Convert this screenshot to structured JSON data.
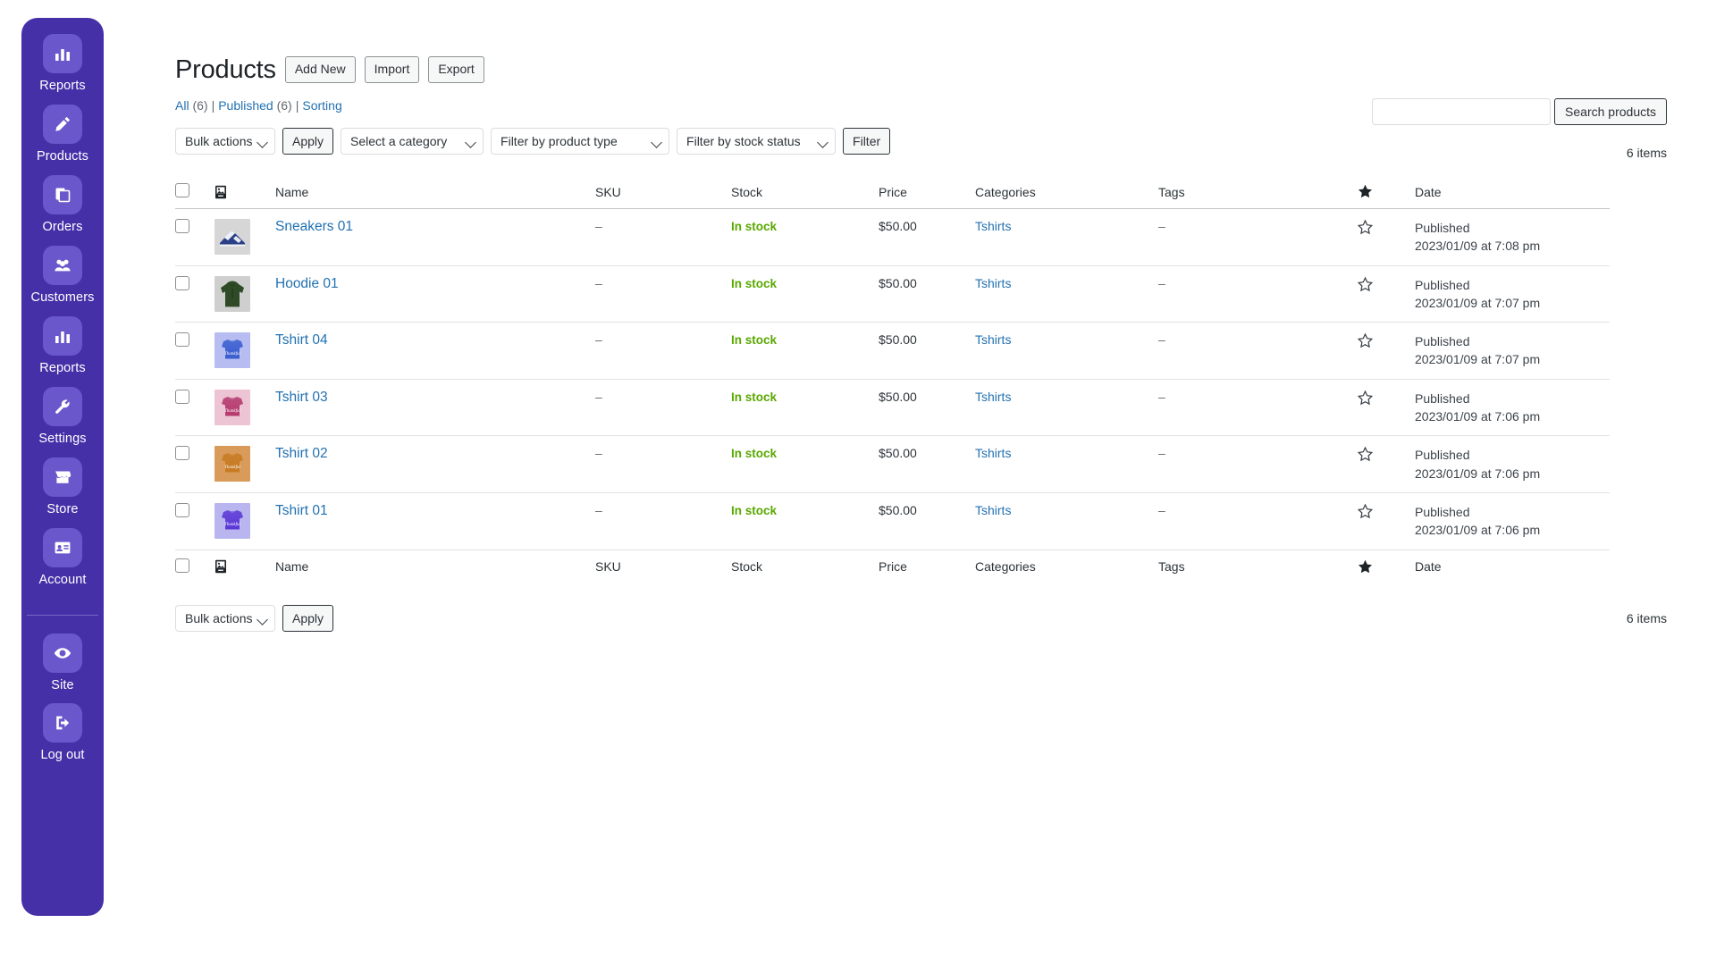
{
  "sidebar": {
    "items": [
      {
        "label": "Reports",
        "icon": "bar-chart-icon"
      },
      {
        "label": "Products",
        "icon": "pencil-icon"
      },
      {
        "label": "Orders",
        "icon": "copy-icon"
      },
      {
        "label": "Customers",
        "icon": "users-icon"
      },
      {
        "label": "Reports",
        "icon": "bar-chart-icon"
      },
      {
        "label": "Settings",
        "icon": "wrench-icon"
      },
      {
        "label": "Store",
        "icon": "storefront-icon"
      },
      {
        "label": "Account",
        "icon": "id-card-icon"
      }
    ],
    "bottom_items": [
      {
        "label": "Site",
        "icon": "eye-icon"
      },
      {
        "label": "Log out",
        "icon": "logout-icon"
      }
    ],
    "colors": {
      "background": "#4530a8",
      "icon_tile": "#6a57cc",
      "text": "#ffffff"
    }
  },
  "header": {
    "title": "Products",
    "buttons": [
      {
        "label": "Add New"
      },
      {
        "label": "Import"
      },
      {
        "label": "Export"
      }
    ]
  },
  "views": {
    "all_label": "All",
    "all_count": "(6)",
    "published_label": "Published",
    "published_count": "(6)",
    "sorting_label": "Sorting",
    "separator": "|"
  },
  "search": {
    "value": "",
    "placeholder": "",
    "button_label": "Search products"
  },
  "tablenav_top": {
    "bulk_actions_label": "Bulk actions",
    "apply_label": "Apply",
    "category_label": "Select a category",
    "product_type_label": "Filter by product type",
    "stock_status_label": "Filter by stock status",
    "filter_label": "Filter",
    "items_count": "6 items"
  },
  "tablenav_bottom": {
    "bulk_actions_label": "Bulk actions",
    "apply_label": "Apply",
    "items_count": "6 items"
  },
  "table": {
    "columns": {
      "checkbox": "",
      "thumb": "image-icon",
      "name": "Name",
      "sku": "SKU",
      "stock": "Stock",
      "price": "Price",
      "categories": "Categories",
      "tags": "Tags",
      "featured": "star-icon",
      "date": "Date"
    },
    "rows": [
      {
        "name": "Sneakers 01",
        "sku": "–",
        "stock": "In stock",
        "price": "$50.00",
        "categories": "Tshirts",
        "tags": "–",
        "featured": false,
        "date_status": "Published",
        "date_value": "2023/01/09 at 7:08 pm",
        "thumb_kind": "sneaker",
        "thumb_bg": "#d6d6d6",
        "thumb_color": "#2b3f87"
      },
      {
        "name": "Hoodie 01",
        "sku": "–",
        "stock": "In stock",
        "price": "$50.00",
        "categories": "Tshirts",
        "tags": "–",
        "featured": false,
        "date_status": "Published",
        "date_value": "2023/01/09 at 7:07 pm",
        "thumb_kind": "hoodie",
        "thumb_bg": "#cfcfcf",
        "thumb_color": "#2f4a26"
      },
      {
        "name": "Tshirt 04",
        "sku": "–",
        "stock": "In stock",
        "price": "$50.00",
        "categories": "Tshirts",
        "tags": "–",
        "featured": false,
        "date_status": "Published",
        "date_value": "2023/01/09 at 7:07 pm",
        "thumb_kind": "tshirt",
        "thumb_bg": "#b7bdf0",
        "thumb_color": "#3a5ed0"
      },
      {
        "name": "Tshirt 03",
        "sku": "–",
        "stock": "In stock",
        "price": "$50.00",
        "categories": "Tshirts",
        "tags": "–",
        "featured": false,
        "date_status": "Published",
        "date_value": "2023/01/09 at 7:06 pm",
        "thumb_kind": "tshirt",
        "thumb_bg": "#ecc4d4",
        "thumb_color": "#b43a6e"
      },
      {
        "name": "Tshirt 02",
        "sku": "–",
        "stock": "In stock",
        "price": "$50.00",
        "categories": "Tshirts",
        "tags": "–",
        "featured": false,
        "date_status": "Published",
        "date_value": "2023/01/09 at 7:06 pm",
        "thumb_kind": "tshirt",
        "thumb_bg": "#d99b5a",
        "thumb_color": "#c77b24"
      },
      {
        "name": "Tshirt 01",
        "sku": "–",
        "stock": "In stock",
        "price": "$50.00",
        "categories": "Tshirts",
        "tags": "–",
        "featured": false,
        "date_status": "Published",
        "date_value": "2023/01/09 at 7:06 pm",
        "thumb_kind": "tshirt",
        "thumb_bg": "#b9b6ef",
        "thumb_color": "#5b38d6"
      }
    ]
  },
  "colors": {
    "accent": "#2271b1",
    "in_stock": "#59a800",
    "sidebar": "#4530a8"
  }
}
